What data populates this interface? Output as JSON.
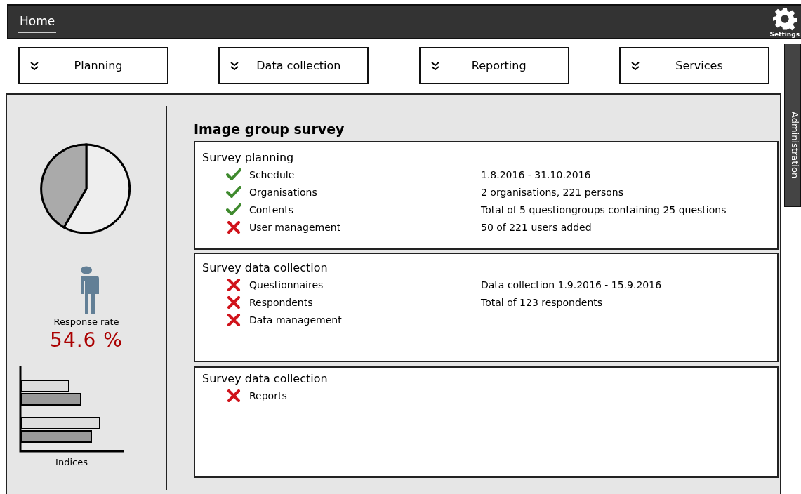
{
  "header": {
    "home": "Home",
    "settings": "Settings"
  },
  "nav": [
    {
      "label": "Planning"
    },
    {
      "label": "Data collection"
    },
    {
      "label": "Reporting"
    },
    {
      "label": "Services"
    }
  ],
  "side_tab": "Administration",
  "summary": {
    "response_label": "Response rate",
    "response_value": "54.6 %",
    "indices_label": "Indices"
  },
  "survey_title": "Image group survey",
  "sections": [
    {
      "title": "Survey planning",
      "items": [
        {
          "name": "Schedule",
          "done": true,
          "detail": "1.8.2016 - 31.10.2016"
        },
        {
          "name": "Organisations",
          "done": true,
          "detail": "2 organisations, 221 persons"
        },
        {
          "name": "Contents",
          "done": true,
          "detail": "Total of 5 questiongroups containing 25 questions"
        },
        {
          "name": "User management",
          "done": false,
          "detail": "50 of 221 users added"
        }
      ]
    },
    {
      "title": "Survey data collection",
      "items": [
        {
          "name": "Questionnaires",
          "done": false,
          "detail": "Data collection 1.9.2016 - 15.9.2016"
        },
        {
          "name": "Respondents",
          "done": false,
          "detail": "Total of 123 respondents"
        },
        {
          "name": "Data management",
          "done": false
        }
      ]
    },
    {
      "title": "Survey data collection",
      "items": [
        {
          "name": "Reports",
          "done": false
        }
      ]
    }
  ]
}
